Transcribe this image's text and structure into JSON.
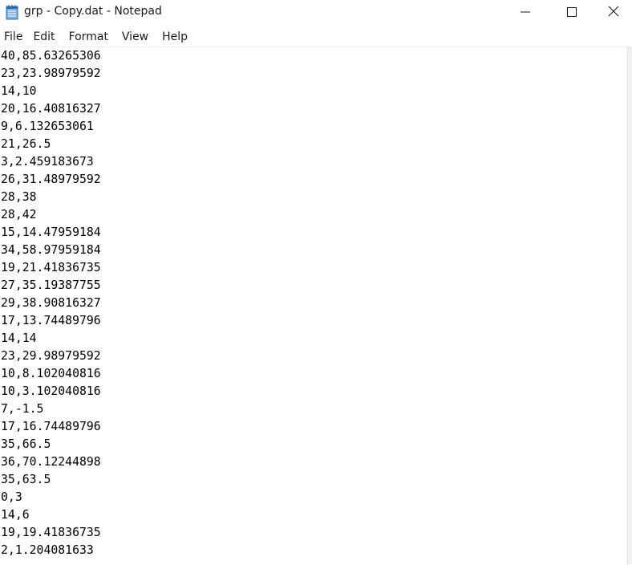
{
  "window": {
    "title": "grp - Copy.dat - Notepad"
  },
  "menu": {
    "items": [
      "File",
      "Edit",
      "Format",
      "View",
      "Help"
    ]
  },
  "document": {
    "lines": [
      "40,85.63265306",
      "23,23.98979592",
      "14,10",
      "20,16.40816327",
      "9,6.132653061",
      "21,26.5",
      "3,2.459183673",
      "26,31.48979592",
      "28,38",
      "28,42",
      "15,14.47959184",
      "34,58.97959184",
      "19,21.41836735",
      "27,35.19387755",
      "29,38.90816327",
      "17,13.74489796",
      "14,14",
      "23,29.98979592",
      "10,8.102040816",
      "10,3.102040816",
      "7,-1.5",
      "17,16.74489796",
      "35,66.5",
      "36,70.12244898",
      "35,63.5",
      "0,3",
      "14,6",
      "19,19.41836735",
      "2,1.204081633"
    ]
  },
  "icons": {
    "app": "notepad-icon",
    "minimize": "minimize-icon",
    "maximize": "maximize-icon",
    "close": "close-icon"
  }
}
